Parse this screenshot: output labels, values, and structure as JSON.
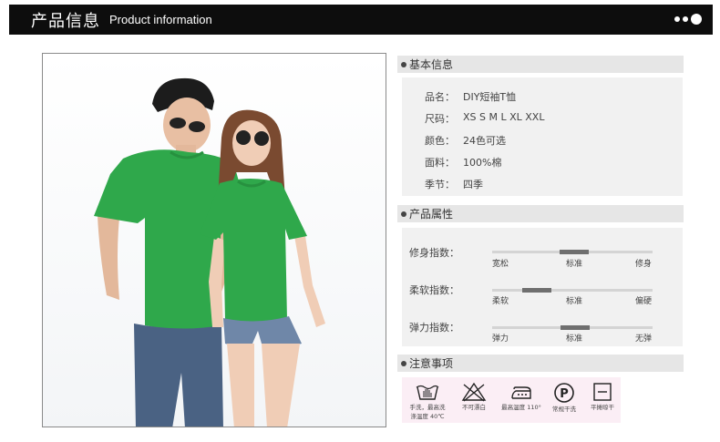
{
  "header": {
    "title_cn": "产品信息",
    "title_en": "Product information"
  },
  "basic_info": {
    "title": "基本信息",
    "rows": [
      {
        "key": "品名：",
        "value": "DIY短袖T恤"
      },
      {
        "key": "尺码：",
        "value": "XS S M L XL XXL"
      },
      {
        "key": "颜色：",
        "value": "24色可选"
      },
      {
        "key": "面料：",
        "value": "100%棉"
      },
      {
        "key": "季节：",
        "value": "四季"
      }
    ]
  },
  "attributes": {
    "title": "产品属性",
    "items": [
      {
        "label": "修身指数：",
        "ticks": [
          "宽松",
          "标准",
          "修身"
        ],
        "level": 0.5
      },
      {
        "label": "柔软指数：",
        "ticks": [
          "柔软",
          "标准",
          "偏硬"
        ],
        "level": 0.2
      },
      {
        "label": "弹力指数：",
        "ticks": [
          "弹力",
          "标准",
          "无弹"
        ],
        "level": 0.5
      }
    ]
  },
  "care": {
    "title": "注意事项",
    "items": [
      {
        "icon": "hand-wash-icon",
        "text1": "手洗，最高洗",
        "text2": "涤温度 40℃"
      },
      {
        "icon": "no-bleach-icon",
        "text1": "不可漂白",
        "text2": ""
      },
      {
        "icon": "iron-icon",
        "text1": "最高温度 110°",
        "text2": ""
      },
      {
        "icon": "dry-clean-p-icon",
        "text1": "常规干洗",
        "text2": ""
      },
      {
        "icon": "flat-dry-icon",
        "text1": "平摊晾干",
        "text2": ""
      }
    ]
  },
  "colors": {
    "shirt": "#2fa84b",
    "jeans": "#4a6283",
    "header_bg": "#0d0d0d"
  }
}
